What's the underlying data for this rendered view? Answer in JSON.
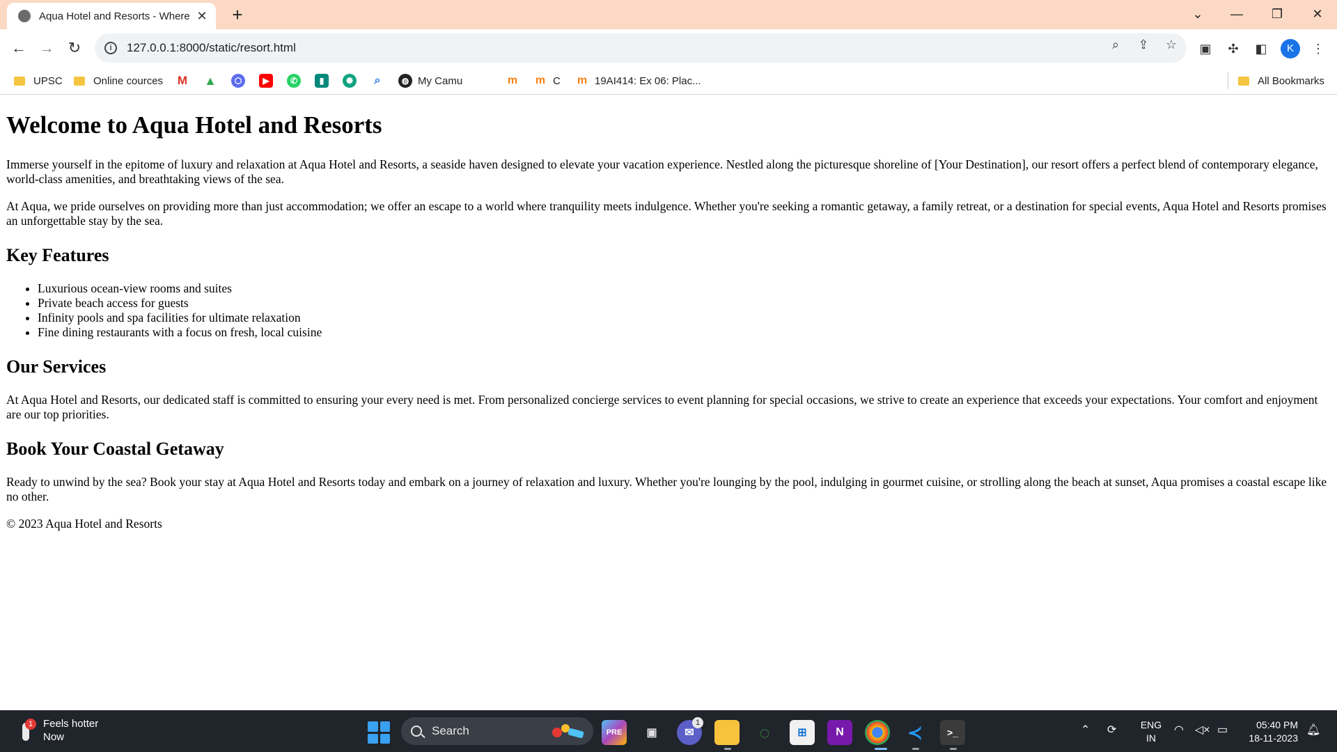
{
  "browser": {
    "tab_title": "Aqua Hotel and Resorts - Where",
    "url": "127.0.0.1:8000/static/resort.html",
    "profile_initial": "K"
  },
  "bookmarks": {
    "items": [
      "UPSC",
      "Online cources",
      "My Camu",
      "C",
      "19AI414: Ex 06: Plac..."
    ],
    "all_bookmarks": "All Bookmarks"
  },
  "page": {
    "h1": "Welcome to Aqua Hotel and Resorts",
    "intro_p1": "Immerse yourself in the epitome of luxury and relaxation at Aqua Hotel and Resorts, a seaside haven designed to elevate your vacation experience. Nestled along the picturesque shoreline of [Your Destination], our resort offers a perfect blend of contemporary elegance, world-class amenities, and breathtaking views of the sea.",
    "intro_p2": "At Aqua, we pride ourselves on providing more than just accommodation; we offer an escape to a world where tranquility meets indulgence. Whether you're seeking a romantic getaway, a family retreat, or a destination for special events, Aqua Hotel and Resorts promises an unforgettable stay by the sea.",
    "features_heading": "Key Features",
    "features": [
      "Luxurious ocean-view rooms and suites",
      "Private beach access for guests",
      "Infinity pools and spa facilities for ultimate relaxation",
      "Fine dining restaurants with a focus on fresh, local cuisine"
    ],
    "services_heading": "Our Services",
    "services_p": "At Aqua Hotel and Resorts, our dedicated staff is committed to ensuring your every need is met. From personalized concierge services to event planning for special occasions, we strive to create an experience that exceeds your expectations. Your comfort and enjoyment are our top priorities.",
    "book_heading": "Book Your Coastal Getaway",
    "book_p": "Ready to unwind by the sea? Book your stay at Aqua Hotel and Resorts today and embark on a journey of relaxation and luxury. Whether you're lounging by the pool, indulging in gourmet cuisine, or strolling along the beach at sunset, Aqua promises a coastal escape like no other.",
    "footer": "© 2023 Aqua Hotel and Resorts"
  },
  "taskbar": {
    "weather_line1": "Feels hotter",
    "weather_line2": "Now",
    "weather_badge": "1",
    "search_label": "Search",
    "teams_badge": "1",
    "lang_line1": "ENG",
    "lang_line2": "IN",
    "time": "05:40 PM",
    "date": "18-11-2023"
  },
  "colors": {
    "tabstrip": "#fbd9c4",
    "taskbar": "#20242b",
    "accent": "#1a73e8"
  }
}
